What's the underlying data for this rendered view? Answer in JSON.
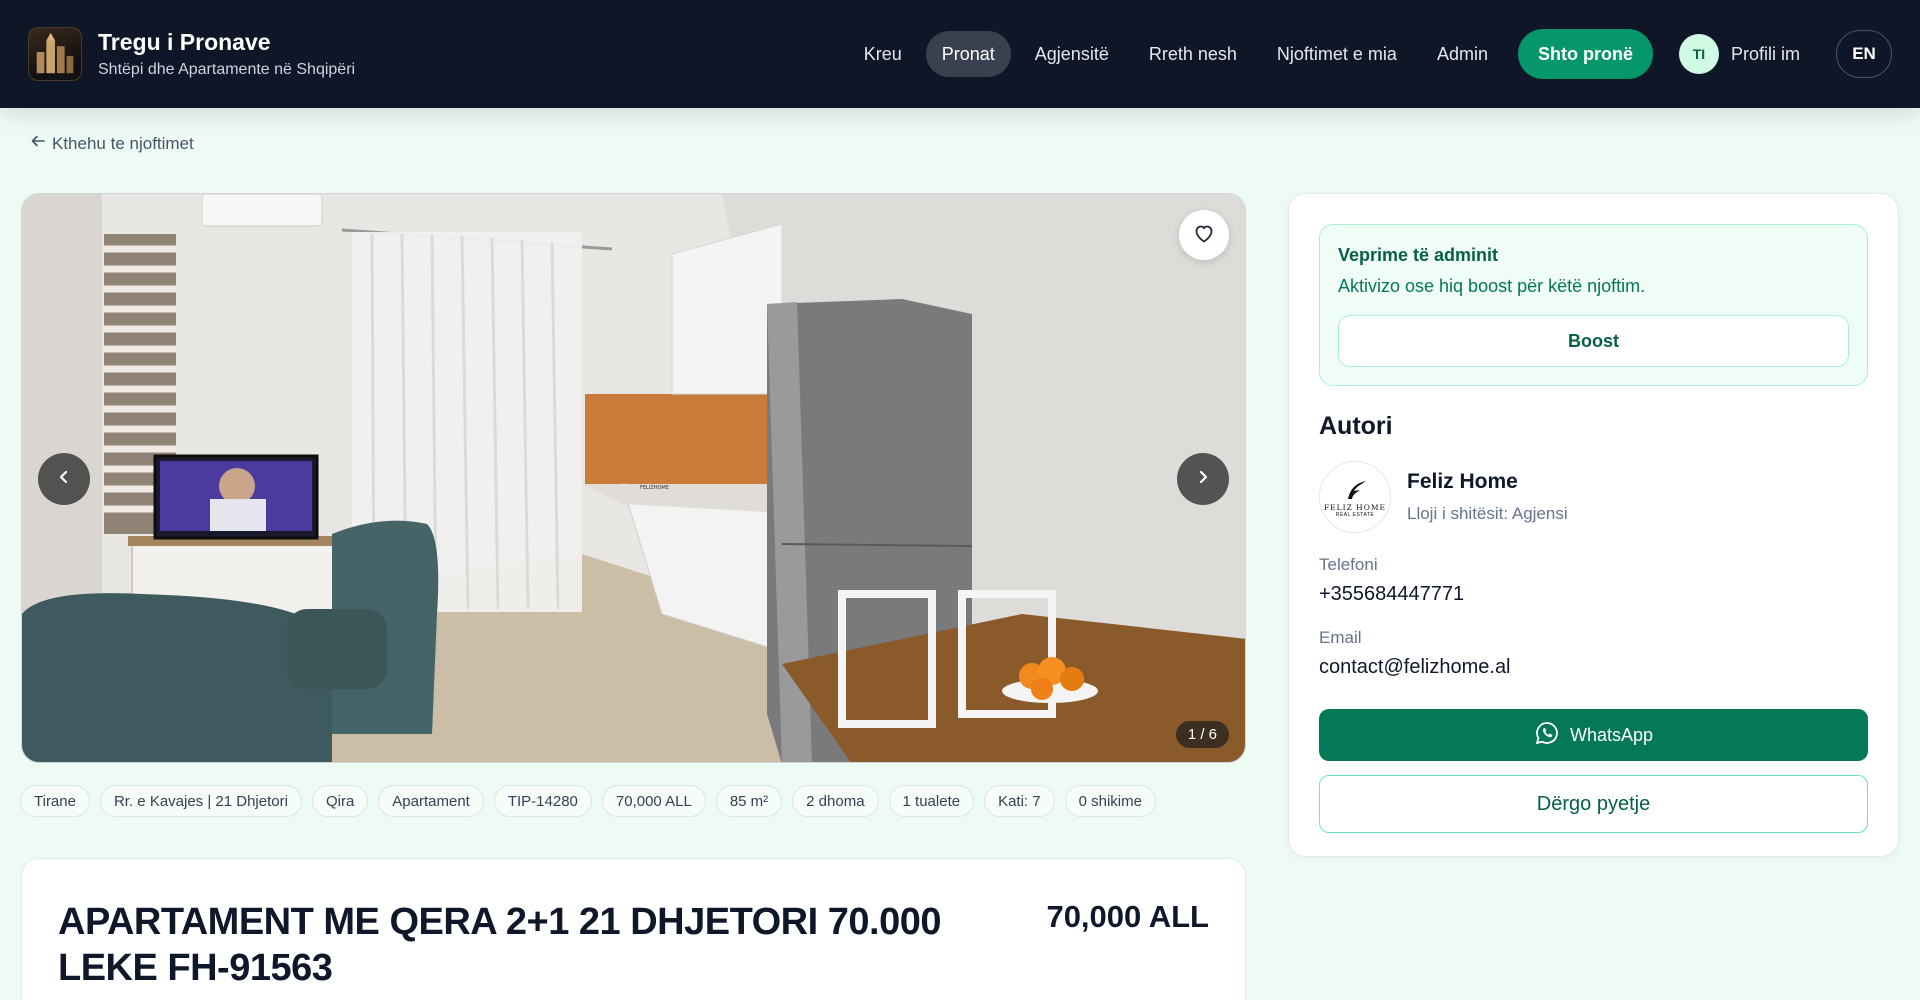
{
  "brand": {
    "title": "Tregu i Pronave",
    "subtitle": "Shtëpi dhe Apartamente në Shqipëri"
  },
  "nav": {
    "items": [
      {
        "label": "Kreu",
        "active": false
      },
      {
        "label": "Pronat",
        "active": true
      },
      {
        "label": "Agjensitë",
        "active": false
      },
      {
        "label": "Rreth nesh",
        "active": false
      },
      {
        "label": "Njoftimet e mia",
        "active": false
      },
      {
        "label": "Admin",
        "active": false
      }
    ],
    "add_button": "Shto pronë",
    "profile_initials": "TI",
    "profile_label": "Profili im",
    "language": "EN"
  },
  "back_link": "Kthehu te njoftimet",
  "gallery": {
    "counter": "1 / 6",
    "current": 1,
    "total": 6
  },
  "chips": [
    "Tirane",
    "Rr. e Kavajes | 21 Dhjetori",
    "Qira",
    "Apartament",
    "TIP-14280",
    "70,000 ALL",
    "85 m²",
    "2 dhoma",
    "1 tualete",
    "Kati: 7",
    "0 shikime"
  ],
  "listing": {
    "title": "APARTAMENT ME QERA 2+1 21 DHJETORI 70.000 LEKE FH-91563",
    "price": "70,000 ALL"
  },
  "admin": {
    "title": "Veprime të adminit",
    "description": "Aktivizo ose hiq boost për këtë njoftim.",
    "boost_label": "Boost"
  },
  "author": {
    "heading": "Autori",
    "name": "Feliz Home",
    "seller_type": "Lloji i shitësit: Agjensi",
    "logo_text": "FELIZ HOME",
    "logo_subtext": "REAL ESTATE",
    "phone_label": "Telefoni",
    "phone": "+355684447771",
    "email_label": "Email",
    "email": "contact@felizhome.al",
    "whatsapp_label": "WhatsApp",
    "ask_label": "Dërgo pyetje"
  },
  "colors": {
    "nav_bg": "#0e1628",
    "accent": "#059669",
    "whatsapp": "#047857",
    "page_bg": "#eefaf4"
  },
  "icons": {
    "back": "arrow-left-icon",
    "favorite": "heart-icon",
    "prev": "chevron-left-icon",
    "next": "chevron-right-icon",
    "whatsapp": "whatsapp-icon"
  }
}
